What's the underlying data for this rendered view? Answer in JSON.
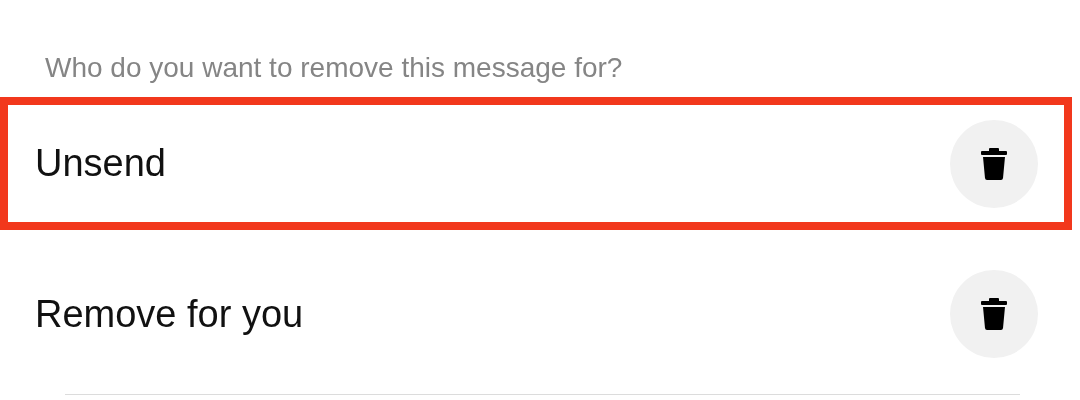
{
  "prompt": "Who do you want to remove this message for?",
  "options": [
    {
      "label": "Unsend",
      "highlighted": true
    },
    {
      "label": "Remove for you",
      "highlighted": false
    }
  ]
}
